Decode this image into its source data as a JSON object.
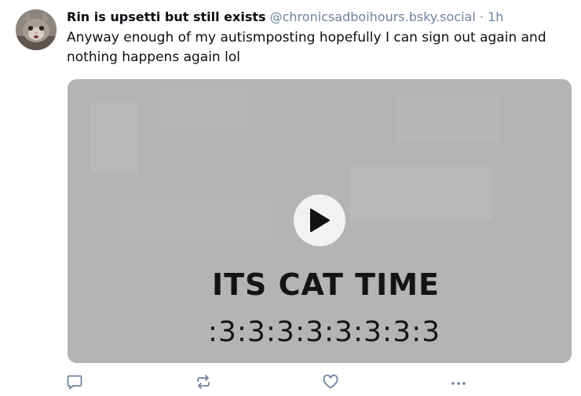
{
  "post": {
    "author": {
      "display_name": "Rin is upsetti but still exists",
      "handle": "@chronicsadboihours.bsky.social"
    },
    "separator": "·",
    "timestamp": "1h",
    "text": "Anyway enough of my autismposting hopefully I can sign out again and nothing happens again lol",
    "video": {
      "caption_line1": "ITS CAT TIME",
      "caption_line2": ":3:3:3:3:3:3:3:3"
    },
    "actions": {
      "reply_icon": "speech-bubble-icon",
      "repost_icon": "repost-arrows-icon",
      "like_icon": "heart-icon",
      "more_icon": "ellipsis-icon"
    }
  },
  "colors": {
    "text": "#0b0f14",
    "muted": "#6f839f",
    "video_bg": "#b3b4b6",
    "icon": "#6f839f"
  }
}
